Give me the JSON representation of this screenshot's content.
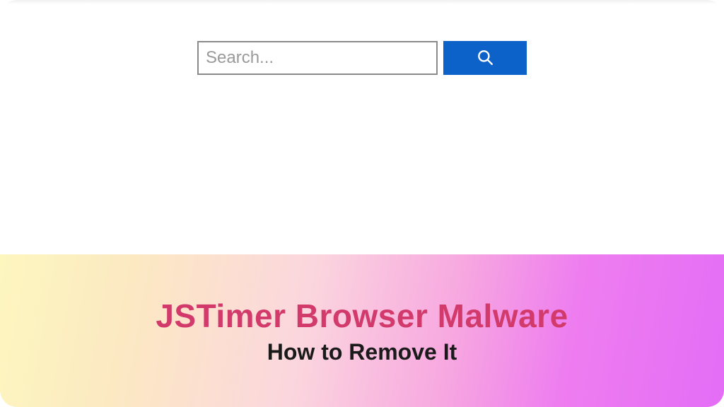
{
  "search": {
    "placeholder": "Search...",
    "value": ""
  },
  "icons": {
    "search": "search-icon"
  },
  "banner": {
    "title": "JSTimer Browser Malware",
    "subtitle": "How to Remove It"
  },
  "colors": {
    "search_button_bg": "#0d62c9",
    "banner_title": "#d23a6b",
    "gradient_from": "#fdf6bf",
    "gradient_to": "#e46df6"
  }
}
